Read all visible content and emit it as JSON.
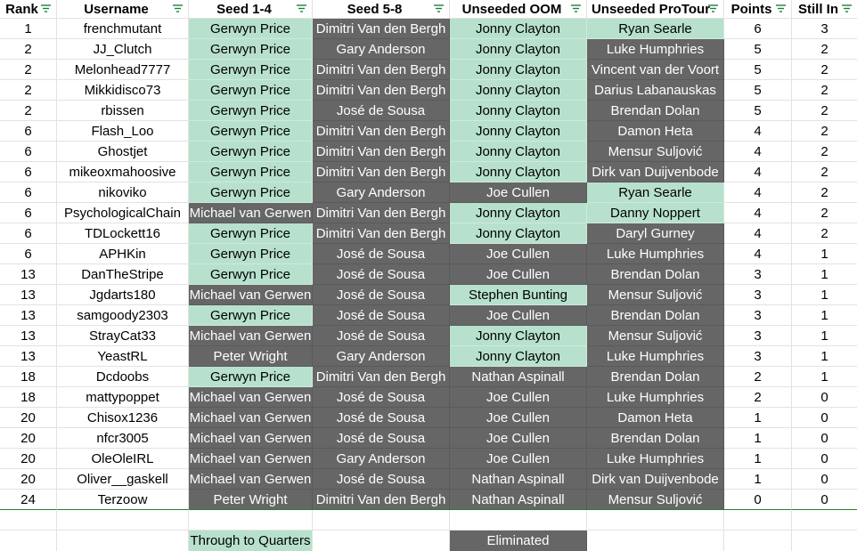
{
  "colors": {
    "through": "#b7e1cd",
    "eliminated": "#666666",
    "filter_icon": "#188038",
    "frozen_line": "#2e7d32"
  },
  "headers": [
    "Rank",
    "Username",
    "Seed 1-4",
    "Seed 5-8",
    "Unseeded OOM",
    "Unseeded ProTour",
    "Points",
    "Still In"
  ],
  "rows": [
    {
      "rank": "1",
      "user": "frenchmutant",
      "s14": "Gerwyn Price",
      "s14_in": true,
      "s58": "Dimitri Van den Bergh",
      "s58_in": false,
      "oom": "Jonny Clayton",
      "oom_in": true,
      "pt": "Ryan Searle",
      "pt_in": true,
      "points": "6",
      "still": "3"
    },
    {
      "rank": "2",
      "user": "JJ_Clutch",
      "s14": "Gerwyn Price",
      "s14_in": true,
      "s58": "Gary Anderson",
      "s58_in": false,
      "oom": "Jonny Clayton",
      "oom_in": true,
      "pt": "Luke Humphries",
      "pt_in": false,
      "points": "5",
      "still": "2"
    },
    {
      "rank": "2",
      "user": "Melonhead7777",
      "s14": "Gerwyn Price",
      "s14_in": true,
      "s58": "Dimitri Van den Bergh",
      "s58_in": false,
      "oom": "Jonny Clayton",
      "oom_in": true,
      "pt": "Vincent van der Voort",
      "pt_in": false,
      "points": "5",
      "still": "2"
    },
    {
      "rank": "2",
      "user": "Mikkidisco73",
      "s14": "Gerwyn Price",
      "s14_in": true,
      "s58": "Dimitri Van den Bergh",
      "s58_in": false,
      "oom": "Jonny Clayton",
      "oom_in": true,
      "pt": "Darius Labanauskas",
      "pt_in": false,
      "points": "5",
      "still": "2"
    },
    {
      "rank": "2",
      "user": "rbissen",
      "s14": "Gerwyn Price",
      "s14_in": true,
      "s58": "José de Sousa",
      "s58_in": false,
      "oom": "Jonny Clayton",
      "oom_in": true,
      "pt": "Brendan Dolan",
      "pt_in": false,
      "points": "5",
      "still": "2"
    },
    {
      "rank": "6",
      "user": "Flash_Loo",
      "s14": "Gerwyn Price",
      "s14_in": true,
      "s58": "Dimitri Van den Bergh",
      "s58_in": false,
      "oom": "Jonny Clayton",
      "oom_in": true,
      "pt": "Damon Heta",
      "pt_in": false,
      "points": "4",
      "still": "2"
    },
    {
      "rank": "6",
      "user": "Ghostjet",
      "s14": "Gerwyn Price",
      "s14_in": true,
      "s58": "Dimitri Van den Bergh",
      "s58_in": false,
      "oom": "Jonny Clayton",
      "oom_in": true,
      "pt": "Mensur Suljović",
      "pt_in": false,
      "points": "4",
      "still": "2"
    },
    {
      "rank": "6",
      "user": "mikeoxmahoosive",
      "s14": "Gerwyn Price",
      "s14_in": true,
      "s58": "Dimitri Van den Bergh",
      "s58_in": false,
      "oom": "Jonny Clayton",
      "oom_in": true,
      "pt": "Dirk van Duijvenbode",
      "pt_in": false,
      "points": "4",
      "still": "2"
    },
    {
      "rank": "6",
      "user": "nikoviko",
      "s14": "Gerwyn Price",
      "s14_in": true,
      "s58": "Gary Anderson",
      "s58_in": false,
      "oom": "Joe Cullen",
      "oom_in": false,
      "pt": "Ryan Searle",
      "pt_in": true,
      "points": "4",
      "still": "2"
    },
    {
      "rank": "6",
      "user": "PsychologicalChain",
      "s14": "Michael van Gerwen",
      "s14_in": false,
      "s58": "Dimitri Van den Bergh",
      "s58_in": false,
      "oom": "Jonny Clayton",
      "oom_in": true,
      "pt": "Danny Noppert",
      "pt_in": true,
      "points": "4",
      "still": "2"
    },
    {
      "rank": "6",
      "user": "TDLockett16",
      "s14": "Gerwyn Price",
      "s14_in": true,
      "s58": "Dimitri Van den Bergh",
      "s58_in": false,
      "oom": "Jonny Clayton",
      "oom_in": true,
      "pt": "Daryl Gurney",
      "pt_in": false,
      "points": "4",
      "still": "2"
    },
    {
      "rank": "6",
      "user": "APHKin",
      "s14": "Gerwyn Price",
      "s14_in": true,
      "s58": "José de Sousa",
      "s58_in": false,
      "oom": "Joe Cullen",
      "oom_in": false,
      "pt": "Luke Humphries",
      "pt_in": false,
      "points": "4",
      "still": "1"
    },
    {
      "rank": "13",
      "user": "DanTheStripe",
      "s14": "Gerwyn Price",
      "s14_in": true,
      "s58": "José de Sousa",
      "s58_in": false,
      "oom": "Joe Cullen",
      "oom_in": false,
      "pt": "Brendan Dolan",
      "pt_in": false,
      "points": "3",
      "still": "1"
    },
    {
      "rank": "13",
      "user": "Jgdarts180",
      "s14": "Michael van Gerwen",
      "s14_in": false,
      "s58": "José de Sousa",
      "s58_in": false,
      "oom": "Stephen Bunting",
      "oom_in": true,
      "pt": "Mensur Suljović",
      "pt_in": false,
      "points": "3",
      "still": "1"
    },
    {
      "rank": "13",
      "user": "samgoody2303",
      "s14": "Gerwyn Price",
      "s14_in": true,
      "s58": "José de Sousa",
      "s58_in": false,
      "oom": "Joe Cullen",
      "oom_in": false,
      "pt": "Brendan Dolan",
      "pt_in": false,
      "points": "3",
      "still": "1"
    },
    {
      "rank": "13",
      "user": "StrayCat33",
      "s14": "Michael van Gerwen",
      "s14_in": false,
      "s58": "José de Sousa",
      "s58_in": false,
      "oom": "Jonny Clayton",
      "oom_in": true,
      "pt": "Mensur Suljović",
      "pt_in": false,
      "points": "3",
      "still": "1"
    },
    {
      "rank": "13",
      "user": "YeastRL",
      "s14": "Peter Wright",
      "s14_in": false,
      "s58": "Gary Anderson",
      "s58_in": false,
      "oom": "Jonny Clayton",
      "oom_in": true,
      "pt": "Luke Humphries",
      "pt_in": false,
      "points": "3",
      "still": "1"
    },
    {
      "rank": "18",
      "user": "Dcdoobs",
      "s14": "Gerwyn Price",
      "s14_in": true,
      "s58": "Dimitri Van den Bergh",
      "s58_in": false,
      "oom": "Nathan Aspinall",
      "oom_in": false,
      "pt": "Brendan Dolan",
      "pt_in": false,
      "points": "2",
      "still": "1"
    },
    {
      "rank": "18",
      "user": "mattypoppet",
      "s14": "Michael van Gerwen",
      "s14_in": false,
      "s58": "José de Sousa",
      "s58_in": false,
      "oom": "Joe Cullen",
      "oom_in": false,
      "pt": "Luke Humphries",
      "pt_in": false,
      "points": "2",
      "still": "0"
    },
    {
      "rank": "20",
      "user": "Chisox1236",
      "s14": "Michael van Gerwen",
      "s14_in": false,
      "s58": "José de Sousa",
      "s58_in": false,
      "oom": "Joe Cullen",
      "oom_in": false,
      "pt": "Damon Heta",
      "pt_in": false,
      "points": "1",
      "still": "0"
    },
    {
      "rank": "20",
      "user": "nfcr3005",
      "s14": "Michael van Gerwen",
      "s14_in": false,
      "s58": "José de Sousa",
      "s58_in": false,
      "oom": "Joe Cullen",
      "oom_in": false,
      "pt": "Brendan Dolan",
      "pt_in": false,
      "points": "1",
      "still": "0"
    },
    {
      "rank": "20",
      "user": "OleOleIRL",
      "s14": "Michael van Gerwen",
      "s14_in": false,
      "s58": "Gary Anderson",
      "s58_in": false,
      "oom": "Joe Cullen",
      "oom_in": false,
      "pt": "Luke Humphries",
      "pt_in": false,
      "points": "1",
      "still": "0"
    },
    {
      "rank": "20",
      "user": "Oliver__gaskell",
      "s14": "Michael van Gerwen",
      "s14_in": false,
      "s58": "José de Sousa",
      "s58_in": false,
      "oom": "Nathan Aspinall",
      "oom_in": false,
      "pt": "Dirk van Duijvenbode",
      "pt_in": false,
      "points": "1",
      "still": "0"
    },
    {
      "rank": "24",
      "user": "Terzoow",
      "s14": "Peter Wright",
      "s14_in": false,
      "s58": "Dimitri Van den Bergh",
      "s58_in": false,
      "oom": "Nathan Aspinall",
      "oom_in": false,
      "pt": "Mensur Suljović",
      "pt_in": false,
      "points": "0",
      "still": "0"
    }
  ],
  "legend": {
    "through_label": "Through to Quarters",
    "eliminated_label": "Eliminated"
  }
}
